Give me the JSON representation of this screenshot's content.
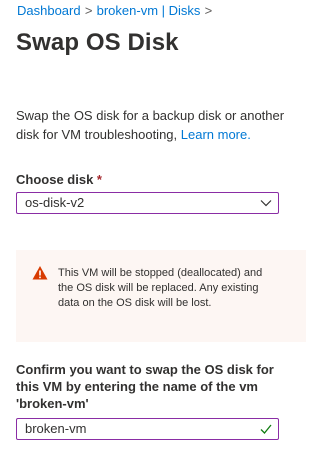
{
  "breadcrumb": {
    "items": [
      {
        "label": "Dashboard"
      },
      {
        "label": "broken-vm | Disks"
      }
    ],
    "separator": ">"
  },
  "page": {
    "title": "Swap OS Disk",
    "description": "Swap the OS disk for a backup disk or another disk for VM troubleshooting,",
    "learn_more": "Learn more."
  },
  "disk_select": {
    "label": "Choose disk",
    "required_marker": "*",
    "value": "os-disk-v2",
    "icon": "chevron-down-icon"
  },
  "warning": {
    "icon": "warning-icon",
    "text": "This VM will be stopped (deallocated) and the OS disk will be replaced. Any existing data on the OS disk will be lost."
  },
  "confirm": {
    "label": "Confirm you want to swap the OS disk for this VM by entering the name of the vm 'broken-vm'",
    "value": "broken-vm",
    "valid_icon": "checkmark-icon"
  },
  "colors": {
    "accent": "#0078d4",
    "focus_border": "#8a2da5",
    "warning_bg": "#fdf6f3",
    "warning_icon": "#d83b01",
    "valid": "#107c10",
    "required": "#a4262c"
  }
}
